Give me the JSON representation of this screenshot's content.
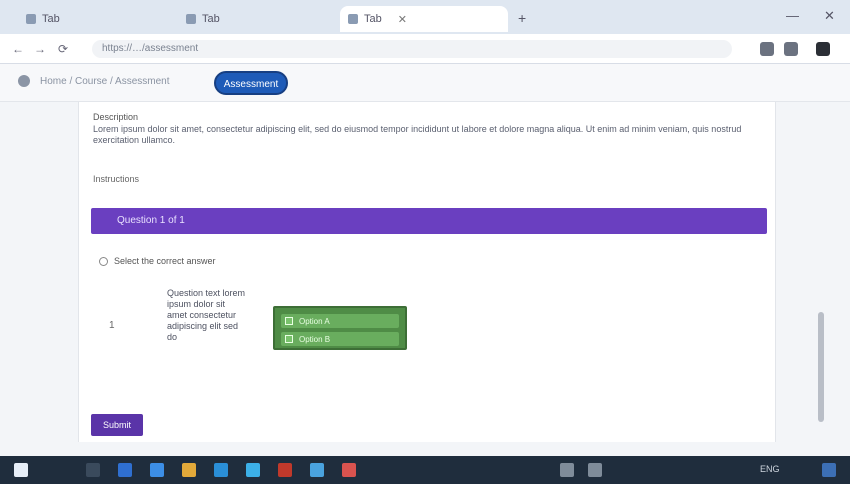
{
  "browser": {
    "tabs": [
      {
        "label": "Tab",
        "active": false
      },
      {
        "label": "Tab",
        "active": false
      },
      {
        "label": "Tab",
        "active": true
      }
    ],
    "new_tab": "+",
    "minimize": "—",
    "close": "✕",
    "back": "←",
    "forward": "→",
    "reload": "⟳",
    "url": "https://…/assessment"
  },
  "app": {
    "breadcrumb": "Home / Course / Assessment",
    "pill_label": "Assessment"
  },
  "content": {
    "description_label": "Description",
    "description_text": "Lorem ipsum dolor sit amet, consectetur adipiscing elit, sed do eiusmod tempor incididunt ut labore et dolore magna aliqua. Ut enim ad minim veniam, quis nostrud exercitation ullamco.",
    "section_label": "Instructions",
    "banner_title": "Question 1 of 1",
    "radio_label": "Select the correct answer",
    "question_number": "1",
    "question_text": "Question text lorem ipsum dolor sit amet consectetur adipiscing elit sed do",
    "options": [
      "Option A",
      "Option B"
    ],
    "submit_label": "Submit"
  },
  "taskbar": {
    "tray_text": "ENG"
  },
  "colors": {
    "banner": "#6a3fc0",
    "option_box": "#4f8c46",
    "pill": "#1e5bb8",
    "submit": "#5a34a8"
  }
}
